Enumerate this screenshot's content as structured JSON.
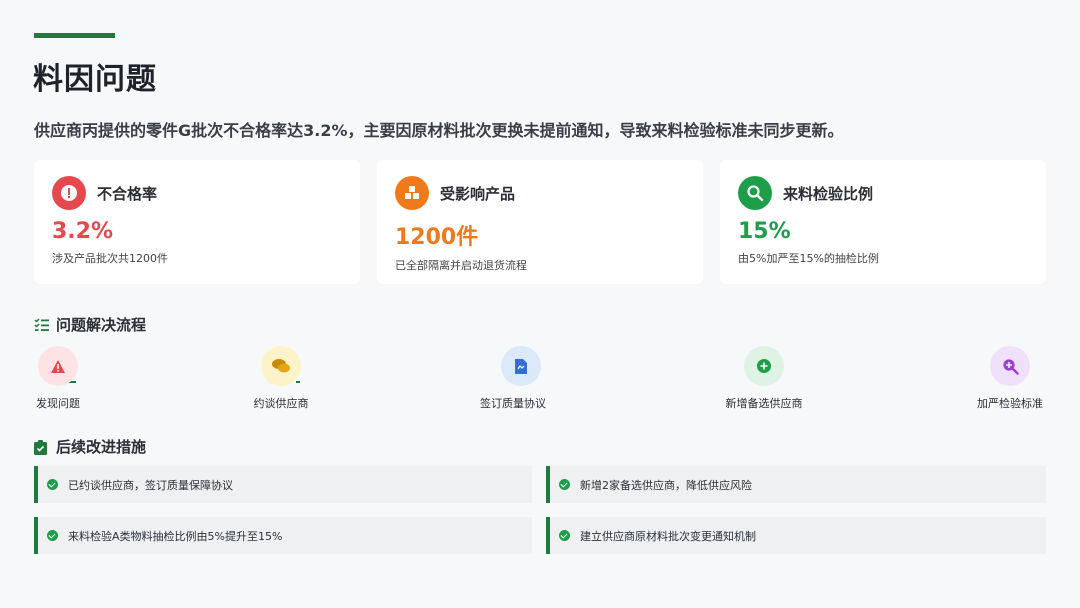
{
  "header": {
    "title": "料因问题",
    "subtitle": "供应商丙提供的零件G批次不合格率达3.2%，主要因原材料批次更换未提前通知，导致来料检验标准未同步更新。"
  },
  "cards": [
    {
      "title": "不合格率",
      "value": "3.2%",
      "note": "涉及产品批次共1200件",
      "color": "#e5484d",
      "icon": "alert-icon"
    },
    {
      "title": "受影响产品",
      "value": "1200件",
      "note": "已全部隔离并启动退货流程",
      "color": "#f07a1a",
      "icon": "boxes-icon"
    },
    {
      "title": "来料检验比例",
      "value": "15%",
      "note": "由5%加严至15%的抽检比例",
      "color": "#1f9e4a",
      "icon": "search-icon"
    }
  ],
  "process": {
    "title": "问题解决流程",
    "steps": [
      {
        "label": "发现问题",
        "icon": "warning-icon",
        "bg": "#fde3e3",
        "fg": "#e5484d"
      },
      {
        "label": "约谈供应商",
        "icon": "chat-icon",
        "bg": "#fdf3c8",
        "fg": "#c98a07"
      },
      {
        "label": "签订质量协议",
        "icon": "document-icon",
        "bg": "#dce9fb",
        "fg": "#2f6fd6"
      },
      {
        "label": "新增备选供应商",
        "icon": "plus-circle-icon",
        "bg": "#dff3e4",
        "fg": "#1f9e4a"
      },
      {
        "label": "加严检验标准",
        "icon": "zoom-in-icon",
        "bg": "#efe1fb",
        "fg": "#9b3fd6"
      }
    ]
  },
  "measures": {
    "title": "后续改进措施",
    "items": [
      "已约谈供应商，签订质量保障协议",
      "新增2家备选供应商，降低供应风险",
      "来料检验A类物料抽检比例由5%提升至15%",
      "建立供应商原材料批次变更通知机制"
    ]
  }
}
